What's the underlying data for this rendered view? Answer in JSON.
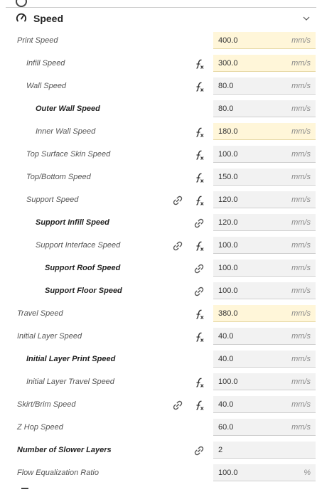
{
  "section": {
    "title": "Speed"
  },
  "settings": [
    {
      "label": "Print Speed",
      "value": "400.0",
      "unit": "mm/s",
      "bold": false,
      "indent": 0,
      "link": false,
      "fx": false,
      "highlight": true
    },
    {
      "label": "Infill Speed",
      "value": "300.0",
      "unit": "mm/s",
      "bold": false,
      "indent": 1,
      "link": false,
      "fx": true,
      "highlight": true
    },
    {
      "label": "Wall Speed",
      "value": "80.0",
      "unit": "mm/s",
      "bold": false,
      "indent": 1,
      "link": false,
      "fx": true,
      "highlight": false
    },
    {
      "label": "Outer Wall Speed",
      "value": "80.0",
      "unit": "mm/s",
      "bold": true,
      "indent": 2,
      "link": false,
      "fx": false,
      "highlight": false
    },
    {
      "label": "Inner Wall Speed",
      "value": "180.0",
      "unit": "mm/s",
      "bold": false,
      "indent": 2,
      "link": false,
      "fx": true,
      "highlight": true
    },
    {
      "label": "Top Surface Skin Speed",
      "value": "100.0",
      "unit": "mm/s",
      "bold": false,
      "indent": 1,
      "link": false,
      "fx": true,
      "highlight": false
    },
    {
      "label": "Top/Bottom Speed",
      "value": "150.0",
      "unit": "mm/s",
      "bold": false,
      "indent": 1,
      "link": false,
      "fx": true,
      "highlight": false
    },
    {
      "label": "Support Speed",
      "value": "120.0",
      "unit": "mm/s",
      "bold": false,
      "indent": 1,
      "link": true,
      "fx": true,
      "highlight": false
    },
    {
      "label": "Support Infill Speed",
      "value": "120.0",
      "unit": "mm/s",
      "bold": true,
      "indent": 2,
      "link": true,
      "fx": false,
      "highlight": false
    },
    {
      "label": "Support Interface Speed",
      "value": "100.0",
      "unit": "mm/s",
      "bold": false,
      "indent": 2,
      "link": true,
      "fx": true,
      "highlight": false
    },
    {
      "label": "Support Roof Speed",
      "value": "100.0",
      "unit": "mm/s",
      "bold": true,
      "indent": 3,
      "link": true,
      "fx": false,
      "highlight": false
    },
    {
      "label": "Support Floor Speed",
      "value": "100.0",
      "unit": "mm/s",
      "bold": true,
      "indent": 3,
      "link": true,
      "fx": false,
      "highlight": false
    },
    {
      "label": "Travel Speed",
      "value": "380.0",
      "unit": "mm/s",
      "bold": false,
      "indent": 0,
      "link": false,
      "fx": true,
      "highlight": true
    },
    {
      "label": "Initial Layer Speed",
      "value": "40.0",
      "unit": "mm/s",
      "bold": false,
      "indent": 0,
      "link": false,
      "fx": true,
      "highlight": false
    },
    {
      "label": "Initial Layer Print Speed",
      "value": "40.0",
      "unit": "mm/s",
      "bold": true,
      "indent": 1,
      "link": false,
      "fx": false,
      "highlight": false
    },
    {
      "label": "Initial Layer Travel Speed",
      "value": "100.0",
      "unit": "mm/s",
      "bold": false,
      "indent": 1,
      "link": false,
      "fx": true,
      "highlight": false
    },
    {
      "label": "Skirt/Brim Speed",
      "value": "40.0",
      "unit": "mm/s",
      "bold": false,
      "indent": 0,
      "link": true,
      "fx": true,
      "highlight": false
    },
    {
      "label": "Z Hop Speed",
      "value": "60.0",
      "unit": "mm/s",
      "bold": false,
      "indent": 0,
      "link": false,
      "fx": false,
      "highlight": false
    },
    {
      "label": "Number of Slower Layers",
      "value": "2",
      "unit": "",
      "bold": true,
      "indent": 0,
      "link": true,
      "fx": false,
      "highlight": false
    },
    {
      "label": "Flow Equalization Ratio",
      "value": "100.0",
      "unit": "%",
      "bold": false,
      "indent": 0,
      "link": false,
      "fx": false,
      "highlight": false
    }
  ]
}
